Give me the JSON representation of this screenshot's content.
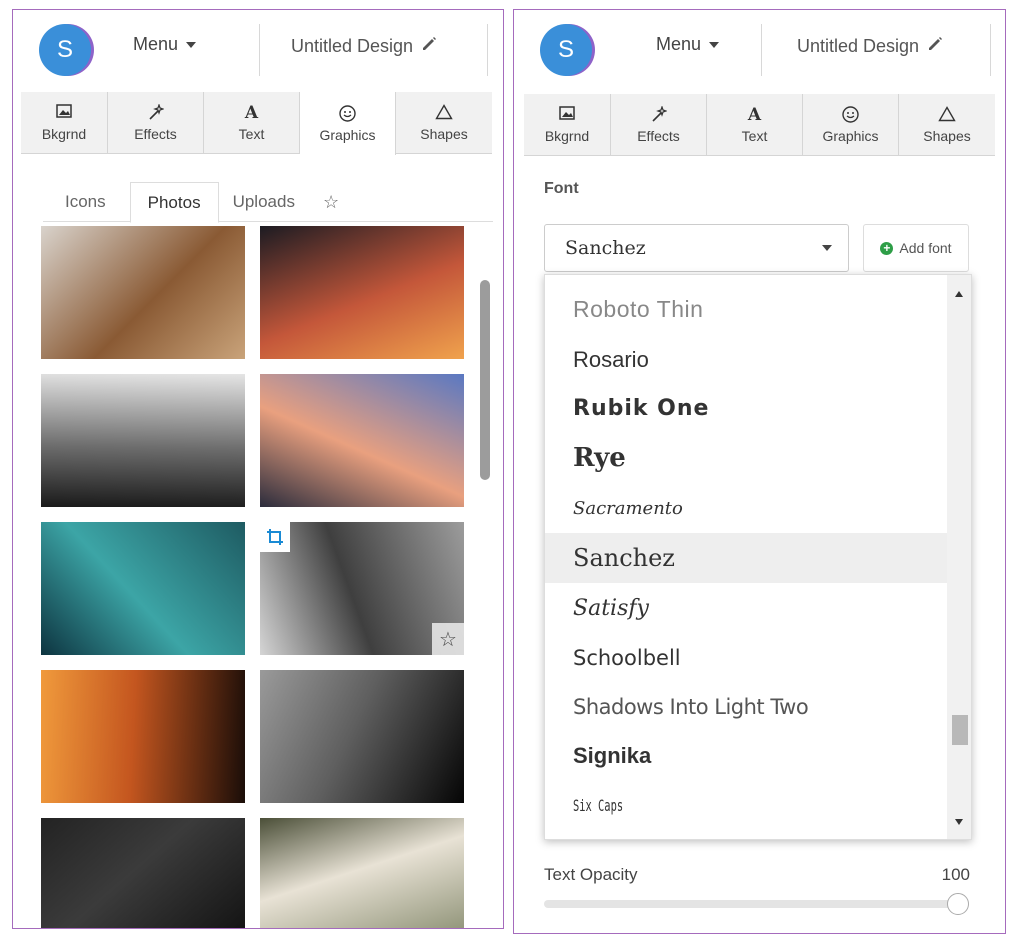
{
  "header": {
    "avatar_letter": "S",
    "menu_label": "Menu",
    "design_title": "Untitled Design"
  },
  "toolbar": {
    "tools": [
      {
        "label": "Bkgrnd",
        "icon": "image-icon"
      },
      {
        "label": "Effects",
        "icon": "magic-wand-icon"
      },
      {
        "label": "Text",
        "icon": "text-icon"
      },
      {
        "label": "Graphics",
        "icon": "smiley-icon"
      },
      {
        "label": "Shapes",
        "icon": "triangle-icon"
      }
    ]
  },
  "graphics_panel": {
    "subtabs": [
      "Icons",
      "Photos",
      "Uploads"
    ],
    "active_subtab": "Photos",
    "favorites_icon": "star-icon",
    "photos": [
      {
        "subject": "granola bowl",
        "colors": [
          "#d9d3cc",
          "#8a5a34",
          "#c9a37a"
        ]
      },
      {
        "subject": "city street reflections at night",
        "colors": [
          "#1c1b22",
          "#c4573a",
          "#f0a24d"
        ]
      },
      {
        "subject": "black and white ocean wave",
        "colors": [
          "#e5e5e5",
          "#6d6d6d",
          "#1a1a1a"
        ]
      },
      {
        "subject": "lighthouse at sunset",
        "colors": [
          "#5a78c2",
          "#e9a07f",
          "#2b2c3c"
        ]
      },
      {
        "subject": "aerial turquoise sea with boats",
        "colors": [
          "#1e5b62",
          "#3ca5a6",
          "#0d3440"
        ]
      },
      {
        "subject": "misty forest",
        "colors": [
          "#9c9c9c",
          "#3f3f3f",
          "#d5d5d5"
        ],
        "badges": [
          "crop-icon",
          "star-icon"
        ]
      },
      {
        "subject": "concert stage lights",
        "colors": [
          "#1a0d08",
          "#c4561f",
          "#f09a3c"
        ]
      },
      {
        "subject": "grey cat on black background",
        "colors": [
          "#050505",
          "#5f5f5f",
          "#9a9a9a"
        ]
      },
      {
        "subject": "dark wooden posts",
        "colors": [
          "#121212",
          "#3b3b3b",
          "#232323"
        ]
      },
      {
        "subject": "woman holding dog in park",
        "colors": [
          "#8b8f73",
          "#e8e2d5",
          "#4b4f38"
        ]
      }
    ]
  },
  "text_panel": {
    "font_label": "Font",
    "selected_font": "Sanchez",
    "add_font_label": "Add font",
    "font_options": [
      "Roboto Thin",
      "Rosario",
      "Rubik One",
      "Rye",
      "Sacramento",
      "Sanchez",
      "Satisfy",
      "Schoolbell",
      "Shadows Into Light Two",
      "Signika",
      "Six Caps"
    ],
    "opacity_label": "Text Opacity",
    "opacity_value": "100"
  }
}
